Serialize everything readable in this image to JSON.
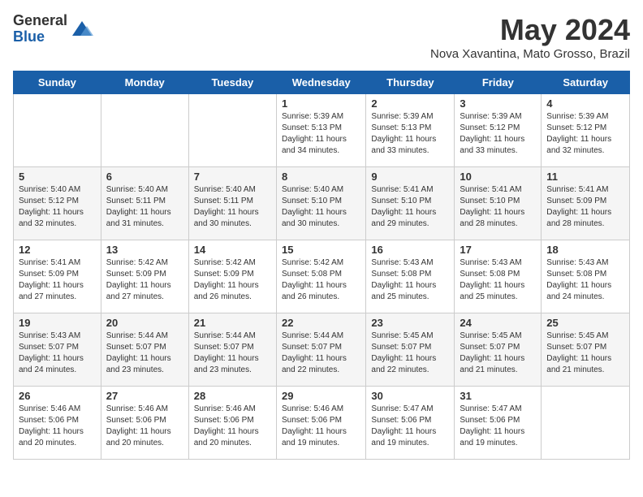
{
  "logo": {
    "general": "General",
    "blue": "Blue"
  },
  "title": "May 2024",
  "location": "Nova Xavantina, Mato Grosso, Brazil",
  "days_of_week": [
    "Sunday",
    "Monday",
    "Tuesday",
    "Wednesday",
    "Thursday",
    "Friday",
    "Saturday"
  ],
  "weeks": [
    [
      {
        "day": "",
        "info": ""
      },
      {
        "day": "",
        "info": ""
      },
      {
        "day": "",
        "info": ""
      },
      {
        "day": "1",
        "info": "Sunrise: 5:39 AM\nSunset: 5:13 PM\nDaylight: 11 hours\nand 34 minutes."
      },
      {
        "day": "2",
        "info": "Sunrise: 5:39 AM\nSunset: 5:13 PM\nDaylight: 11 hours\nand 33 minutes."
      },
      {
        "day": "3",
        "info": "Sunrise: 5:39 AM\nSunset: 5:12 PM\nDaylight: 11 hours\nand 33 minutes."
      },
      {
        "day": "4",
        "info": "Sunrise: 5:39 AM\nSunset: 5:12 PM\nDaylight: 11 hours\nand 32 minutes."
      }
    ],
    [
      {
        "day": "5",
        "info": "Sunrise: 5:40 AM\nSunset: 5:12 PM\nDaylight: 11 hours\nand 32 minutes."
      },
      {
        "day": "6",
        "info": "Sunrise: 5:40 AM\nSunset: 5:11 PM\nDaylight: 11 hours\nand 31 minutes."
      },
      {
        "day": "7",
        "info": "Sunrise: 5:40 AM\nSunset: 5:11 PM\nDaylight: 11 hours\nand 30 minutes."
      },
      {
        "day": "8",
        "info": "Sunrise: 5:40 AM\nSunset: 5:10 PM\nDaylight: 11 hours\nand 30 minutes."
      },
      {
        "day": "9",
        "info": "Sunrise: 5:41 AM\nSunset: 5:10 PM\nDaylight: 11 hours\nand 29 minutes."
      },
      {
        "day": "10",
        "info": "Sunrise: 5:41 AM\nSunset: 5:10 PM\nDaylight: 11 hours\nand 28 minutes."
      },
      {
        "day": "11",
        "info": "Sunrise: 5:41 AM\nSunset: 5:09 PM\nDaylight: 11 hours\nand 28 minutes."
      }
    ],
    [
      {
        "day": "12",
        "info": "Sunrise: 5:41 AM\nSunset: 5:09 PM\nDaylight: 11 hours\nand 27 minutes."
      },
      {
        "day": "13",
        "info": "Sunrise: 5:42 AM\nSunset: 5:09 PM\nDaylight: 11 hours\nand 27 minutes."
      },
      {
        "day": "14",
        "info": "Sunrise: 5:42 AM\nSunset: 5:09 PM\nDaylight: 11 hours\nand 26 minutes."
      },
      {
        "day": "15",
        "info": "Sunrise: 5:42 AM\nSunset: 5:08 PM\nDaylight: 11 hours\nand 26 minutes."
      },
      {
        "day": "16",
        "info": "Sunrise: 5:43 AM\nSunset: 5:08 PM\nDaylight: 11 hours\nand 25 minutes."
      },
      {
        "day": "17",
        "info": "Sunrise: 5:43 AM\nSunset: 5:08 PM\nDaylight: 11 hours\nand 25 minutes."
      },
      {
        "day": "18",
        "info": "Sunrise: 5:43 AM\nSunset: 5:08 PM\nDaylight: 11 hours\nand 24 minutes."
      }
    ],
    [
      {
        "day": "19",
        "info": "Sunrise: 5:43 AM\nSunset: 5:07 PM\nDaylight: 11 hours\nand 24 minutes."
      },
      {
        "day": "20",
        "info": "Sunrise: 5:44 AM\nSunset: 5:07 PM\nDaylight: 11 hours\nand 23 minutes."
      },
      {
        "day": "21",
        "info": "Sunrise: 5:44 AM\nSunset: 5:07 PM\nDaylight: 11 hours\nand 23 minutes."
      },
      {
        "day": "22",
        "info": "Sunrise: 5:44 AM\nSunset: 5:07 PM\nDaylight: 11 hours\nand 22 minutes."
      },
      {
        "day": "23",
        "info": "Sunrise: 5:45 AM\nSunset: 5:07 PM\nDaylight: 11 hours\nand 22 minutes."
      },
      {
        "day": "24",
        "info": "Sunrise: 5:45 AM\nSunset: 5:07 PM\nDaylight: 11 hours\nand 21 minutes."
      },
      {
        "day": "25",
        "info": "Sunrise: 5:45 AM\nSunset: 5:07 PM\nDaylight: 11 hours\nand 21 minutes."
      }
    ],
    [
      {
        "day": "26",
        "info": "Sunrise: 5:46 AM\nSunset: 5:06 PM\nDaylight: 11 hours\nand 20 minutes."
      },
      {
        "day": "27",
        "info": "Sunrise: 5:46 AM\nSunset: 5:06 PM\nDaylight: 11 hours\nand 20 minutes."
      },
      {
        "day": "28",
        "info": "Sunrise: 5:46 AM\nSunset: 5:06 PM\nDaylight: 11 hours\nand 20 minutes."
      },
      {
        "day": "29",
        "info": "Sunrise: 5:46 AM\nSunset: 5:06 PM\nDaylight: 11 hours\nand 19 minutes."
      },
      {
        "day": "30",
        "info": "Sunrise: 5:47 AM\nSunset: 5:06 PM\nDaylight: 11 hours\nand 19 minutes."
      },
      {
        "day": "31",
        "info": "Sunrise: 5:47 AM\nSunset: 5:06 PM\nDaylight: 11 hours\nand 19 minutes."
      },
      {
        "day": "",
        "info": ""
      }
    ]
  ]
}
